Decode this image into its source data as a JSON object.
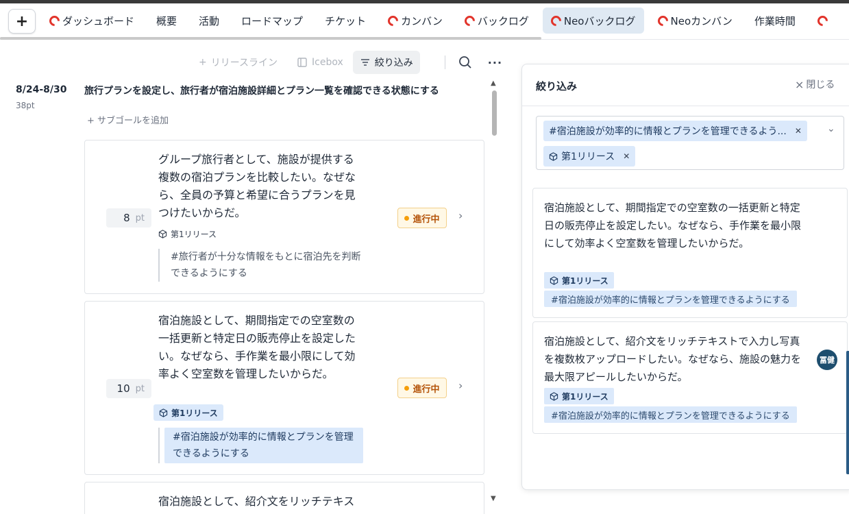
{
  "tabs": [
    {
      "label": "ダッシュボード",
      "icon": "loop-icon",
      "active": false
    },
    {
      "label": "概要",
      "icon": null,
      "active": false
    },
    {
      "label": "活動",
      "icon": null,
      "active": false
    },
    {
      "label": "ロードマップ",
      "icon": null,
      "active": false
    },
    {
      "label": "チケット",
      "icon": null,
      "active": false
    },
    {
      "label": "カンバン",
      "icon": "loop-icon",
      "active": false
    },
    {
      "label": "バックログ",
      "icon": "loop-icon",
      "active": false
    },
    {
      "label": "Neoバックログ",
      "icon": "loop-icon",
      "active": true
    },
    {
      "label": "Neoカンバン",
      "icon": "loop-icon",
      "active": false
    },
    {
      "label": "作業時間",
      "icon": null,
      "active": false
    }
  ],
  "toolbar": {
    "release_line": "リリースライン",
    "icebox": "Icebox",
    "filter": "絞り込み"
  },
  "sprint": {
    "period": "8/24-8/30",
    "points": "38pt",
    "goal": "旅行プランを設定し、旅行者が宿泊施設詳細とプラン一覧を確認できる状態にする",
    "add_subgoal": "サブゴールを追加"
  },
  "cards": [
    {
      "text": "グループ旅行者として、施設が提供する複数の宿泊プランを比較したい。なぜなら、全員の予算と希望に合うプランを見つけたいからだ。",
      "points": "8",
      "unit": "pt",
      "status": "進行中",
      "release": "第1リリース",
      "goal": "#旅行者が十分な情報をもとに宿泊先を判断できるようにする"
    },
    {
      "text": "宿泊施設として、期間指定での空室数の一括更新と特定日の販売停止を設定したい。なぜなら、手作業を最小限にして効率よく空室数を管理したいからだ。",
      "points": "10",
      "unit": "pt",
      "status": "進行中",
      "release": "第1リリース",
      "goal": "#宿泊施設が効率的に情報とプランを管理できるようにする"
    },
    {
      "text": "宿泊施設として、紹介文をリッチテキス"
    }
  ],
  "filter_panel": {
    "title": "絞り込み",
    "close": "閉じる",
    "chips": [
      "#宿泊施設が効率的に情報とプランを管理できるよう...",
      "第1リリース"
    ],
    "results": [
      {
        "text": "宿泊施設として、期間指定での空室数の一括更新と特定日の販売停止を設定したい。なぜなら、手作業を最小限にして効率よく空室数を管理したいからだ。",
        "release": "第1リリース",
        "goal": "#宿泊施設が効率的に情報とプランを管理できるようにする"
      },
      {
        "text": "宿泊施設として、紹介文をリッチテキストで入力し写真を複数枚アップロードしたい。なぜなら、施設の魅力を最大限アピールしたいからだ。",
        "release": "第1リリース",
        "goal": "#宿泊施設が効率的に情報とプランを管理できるようにする",
        "assignee": "冨健"
      }
    ]
  },
  "colors": {
    "accent_loop": "#e2342b",
    "active_tab": "#dfe9f3",
    "chip_bg": "#dbe9fb",
    "status_text": "#b45309"
  }
}
